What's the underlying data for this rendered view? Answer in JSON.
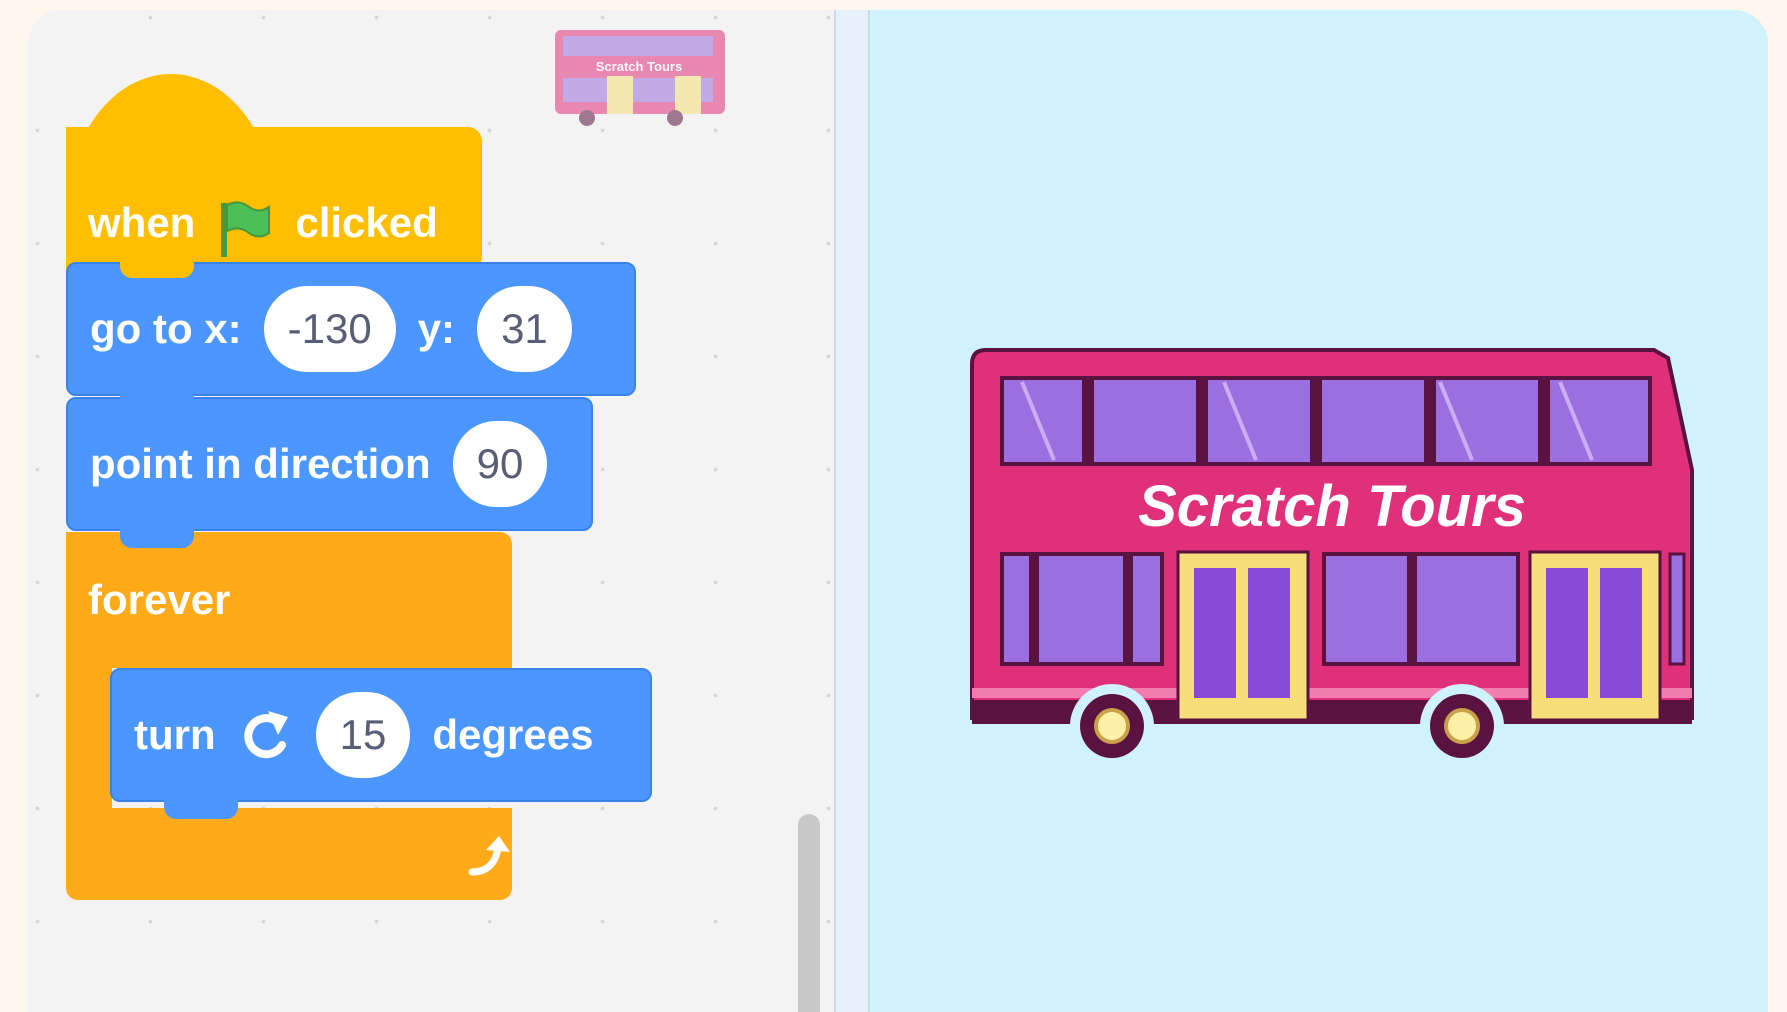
{
  "script": {
    "when_flag_clicked": {
      "when_label": "when",
      "clicked_label": "clicked",
      "flag_icon": "green-flag-icon"
    },
    "go_to": {
      "label": "go to x:",
      "x_value": "-130",
      "y_label": "y:",
      "y_value": "31"
    },
    "point_in_direction": {
      "label": "point in direction",
      "value": "90"
    },
    "forever": {
      "label": "forever",
      "loop_icon": "loop-arrow-icon"
    },
    "turn": {
      "label": "turn",
      "value": "15",
      "unit_label": "degrees",
      "icon": "rotate-clockwise-icon"
    }
  },
  "sprite": {
    "name": "bus",
    "bus_text": "Scratch Tours"
  },
  "colors": {
    "events": "#ffbf00",
    "motion": "#4c97ff",
    "control": "#ffab19",
    "stage_background": "#cff2fd",
    "bus_body": "#e0307a",
    "bus_window": "#9b6fe0"
  }
}
